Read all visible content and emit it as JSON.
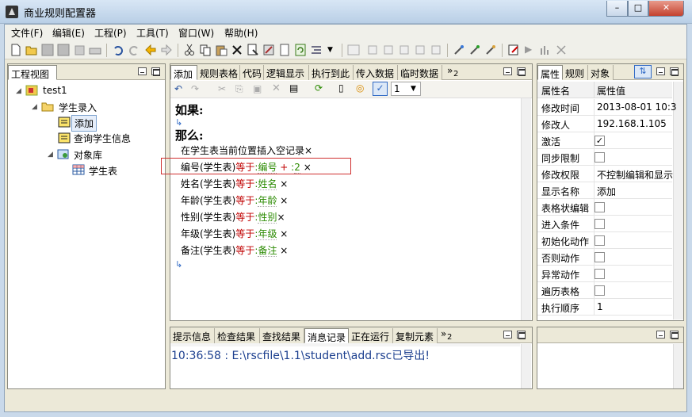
{
  "window": {
    "title": "商业规则配置器",
    "buttons": {
      "minimize": "–",
      "maximize": "□",
      "close": "✕"
    }
  },
  "menu": [
    "文件(F)",
    "编辑(E)",
    "工程(P)",
    "工具(T)",
    "窗口(W)",
    "帮助(H)"
  ],
  "toolbar": {
    "icons": [
      "new-icon",
      "open-icon",
      "save-icon",
      "save-disabled-icon",
      "save-all-icon",
      "print-icon",
      "undo-icon",
      "redo-icon",
      "back-icon",
      "forward-icon",
      "cut-icon",
      "copy-icon",
      "paste-icon",
      "delete-icon",
      "properties-icon",
      "tool-icon",
      "doc-icon",
      "refresh-icon",
      "list-icon",
      "dropdown-icon",
      "grid-disabled-icon",
      "a1-icon",
      "a2-icon",
      "a3-icon",
      "a4-icon",
      "a5-icon",
      "wand1-icon",
      "wand2-icon",
      "wand3-icon",
      "edit-icon",
      "play-icon",
      "bars-icon",
      "tools-icon"
    ]
  },
  "project_view": {
    "title": "工程视图",
    "tree": {
      "root": "test1",
      "student_entry": "学生录入",
      "add": "添加",
      "query": "查询学生信息",
      "object_lib": "对象库",
      "student_table": "学生表"
    }
  },
  "editor": {
    "tabs": [
      "添加",
      "规则表格",
      "代码",
      "逻辑显示",
      "执行到此",
      "传入数据",
      "临时数据"
    ],
    "overflow": "»",
    "overflow_count": "2",
    "zoom_value": "1",
    "if_label": "如果:",
    "then_label": "那么:",
    "lines": [
      {
        "text": "在学生表当前位置插入空记录"
      },
      {
        "field": "编号(学生表)",
        "op": "等于",
        "value": "编号",
        "extra_op": "+",
        "extra_val": "2"
      },
      {
        "field": "姓名(学生表)",
        "op": "等于",
        "value": "姓名"
      },
      {
        "field": "年龄(学生表)",
        "op": "等于",
        "value": "年龄"
      },
      {
        "field": "性别(学生表)",
        "op": "等于",
        "value": "性别"
      },
      {
        "field": "年级(学生表)",
        "op": "等于",
        "value": "年级"
      },
      {
        "field": "备注(学生表)",
        "op": "等于",
        "value": "备注"
      }
    ],
    "x_mark": "×",
    "colon": ":"
  },
  "bottom": {
    "tabs": [
      "提示信息",
      "检查结果",
      "查找结果",
      "消息记录",
      "正在运行",
      "复制元素"
    ],
    "overflow": "»",
    "overflow_count": "2",
    "log_line": "10:36:58 : E:\\rscfile\\1.1\\student\\add.rsc已导出!"
  },
  "properties": {
    "tabs": [
      "属性",
      "规则",
      "对象"
    ],
    "col_name": "属性名",
    "col_value": "属性值",
    "rows": [
      {
        "name": "修改时间",
        "value": "2013-08-01 10:3"
      },
      {
        "name": "修改人",
        "value": "192.168.1.105"
      },
      {
        "name": "激活",
        "check": true
      },
      {
        "name": "同步限制",
        "check": false
      },
      {
        "name": "修改权限",
        "value": "不控制编辑和显示"
      },
      {
        "name": "显示名称",
        "value": "添加"
      },
      {
        "name": "表格状编辑",
        "check": false
      },
      {
        "name": "进入条件",
        "check": false
      },
      {
        "name": "初始化动作",
        "check": false
      },
      {
        "name": "否则动作",
        "check": false
      },
      {
        "name": "异常动作",
        "check": false
      },
      {
        "name": "遍历表格",
        "check": false
      },
      {
        "name": "执行顺序",
        "value": "1"
      }
    ]
  },
  "colors": {
    "accent_blue": "#316ac5",
    "highlight_red": "#d03030",
    "rule_red": "#c00000",
    "rule_green": "#2a8a00"
  }
}
